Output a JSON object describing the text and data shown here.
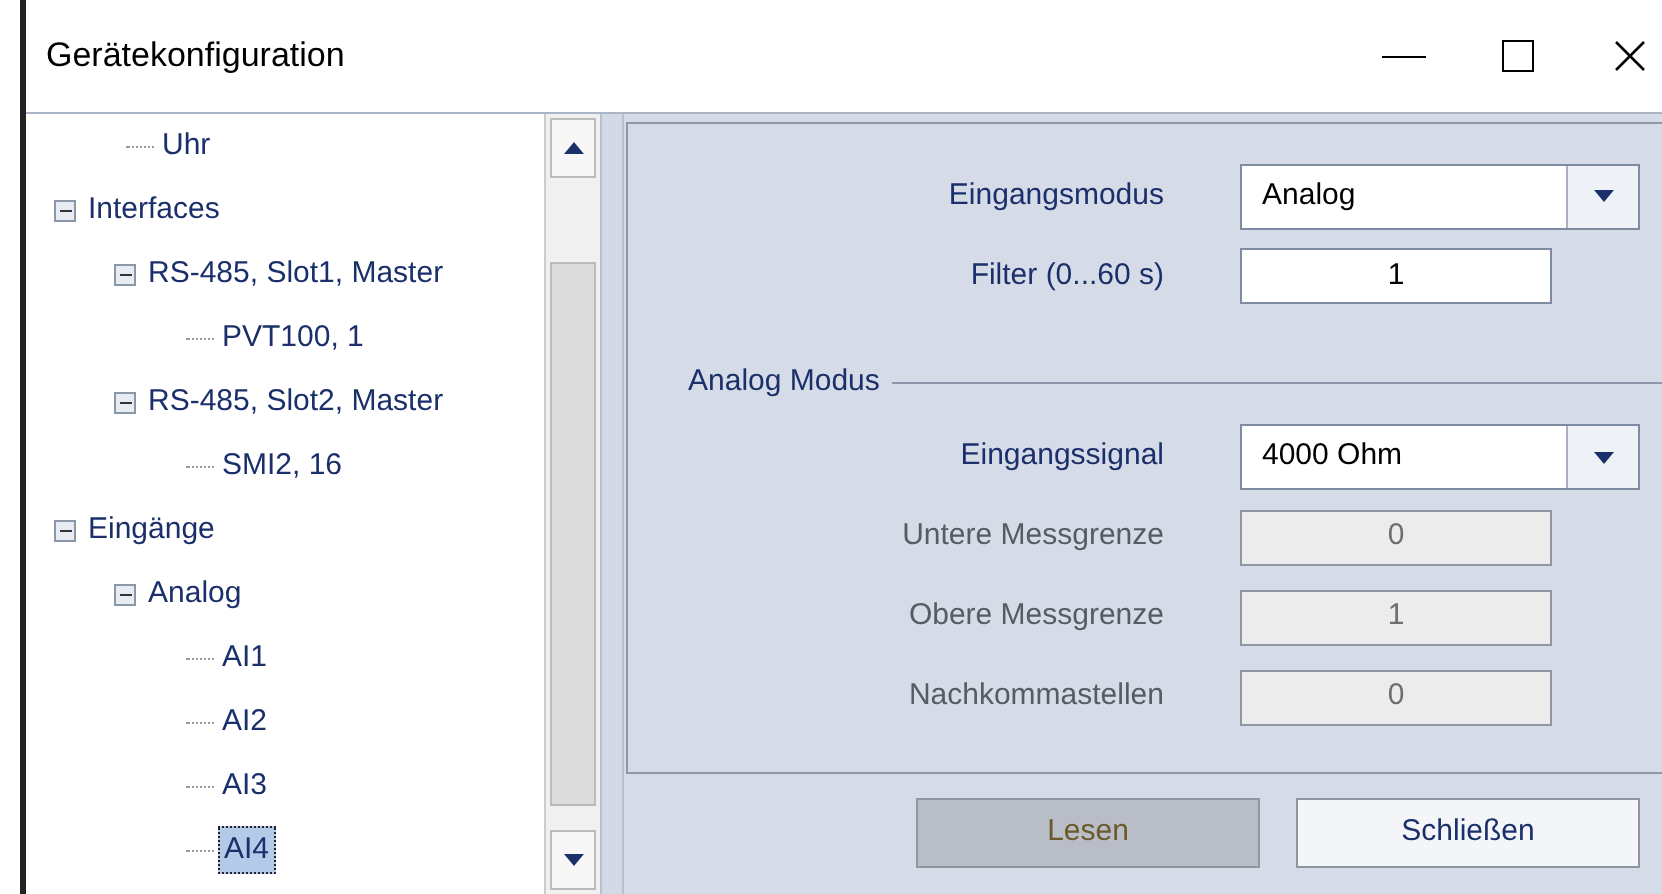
{
  "window": {
    "title": "Gerätekonfiguration"
  },
  "tree": [
    {
      "children": [
        {
          "label": "Uhr",
          "selected": false
        }
      ]
    },
    {
      "label": "Interfaces",
      "expanded": true,
      "selected": false,
      "children": [
        {
          "label": "RS-485, Slot1, Master",
          "expanded": true,
          "selected": false,
          "children": [
            {
              "label": "PVT100, 1",
              "selected": false
            }
          ]
        },
        {
          "label": "RS-485, Slot2, Master",
          "expanded": true,
          "selected": false,
          "children": [
            {
              "label": "SMI2, 16",
              "selected": false
            }
          ]
        }
      ]
    },
    {
      "label": "Eingänge",
      "expanded": true,
      "selected": false,
      "children": [
        {
          "label": "Analog",
          "expanded": true,
          "selected": false,
          "children": [
            {
              "label": "AI1",
              "selected": false
            },
            {
              "label": "AI2",
              "selected": false
            },
            {
              "label": "AI3",
              "selected": false
            },
            {
              "label": "AI4",
              "selected": true
            }
          ]
        }
      ]
    }
  ],
  "form": {
    "fields": [
      {
        "kind": "dropdown",
        "label": "Eingangsmodus",
        "value": "Analog",
        "disabled": false
      },
      {
        "kind": "text",
        "label": "Filter (0...60 s)",
        "value": "1",
        "disabled": false
      }
    ],
    "section": {
      "title": "Analog Modus",
      "fields": [
        {
          "kind": "dropdown",
          "label": "Eingangssignal",
          "value": "4000 Ohm",
          "disabled": false
        },
        {
          "kind": "text",
          "label": "Untere Messgrenze",
          "value": "0",
          "disabled": true
        },
        {
          "kind": "text",
          "label": "Obere Messgrenze",
          "value": "1",
          "disabled": true
        },
        {
          "kind": "text",
          "label": "Nachkommastellen",
          "value": "0",
          "disabled": true
        }
      ]
    }
  },
  "buttons": [
    {
      "label": "Lesen",
      "disabled": true
    },
    {
      "label": "Schließen",
      "disabled": false
    }
  ]
}
